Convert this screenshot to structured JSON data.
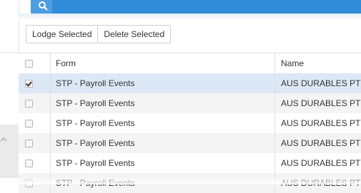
{
  "colors": {
    "topbar": "#2f8bd8",
    "selected_row": "#dde8f6",
    "alt_row": "#f4f4f4"
  },
  "icons": {
    "search": "search-icon",
    "sidebar_toggle": "chevron-up-icon"
  },
  "toolbar": {
    "lodge_label": "Lodge Selected",
    "delete_label": "Delete Selected"
  },
  "grid": {
    "columns": [
      "",
      "Form",
      "Name"
    ],
    "rows": [
      {
        "checked": true,
        "form": "STP - Payroll Events",
        "name": "AUS DURABLES PTY"
      },
      {
        "checked": false,
        "form": "STP - Payroll Events",
        "name": "AUS DURABLES PTY"
      },
      {
        "checked": false,
        "form": "STP - Payroll Events",
        "name": "AUS DURABLES PTY"
      },
      {
        "checked": false,
        "form": "STP - Payroll Events",
        "name": "AUS DURABLES PTY"
      },
      {
        "checked": false,
        "form": "STP - Payroll Events",
        "name": "AUS DURABLES PTY"
      },
      {
        "checked": false,
        "form": "STP - Payroll Events",
        "name": "AUS DURABLES PTY"
      }
    ]
  }
}
